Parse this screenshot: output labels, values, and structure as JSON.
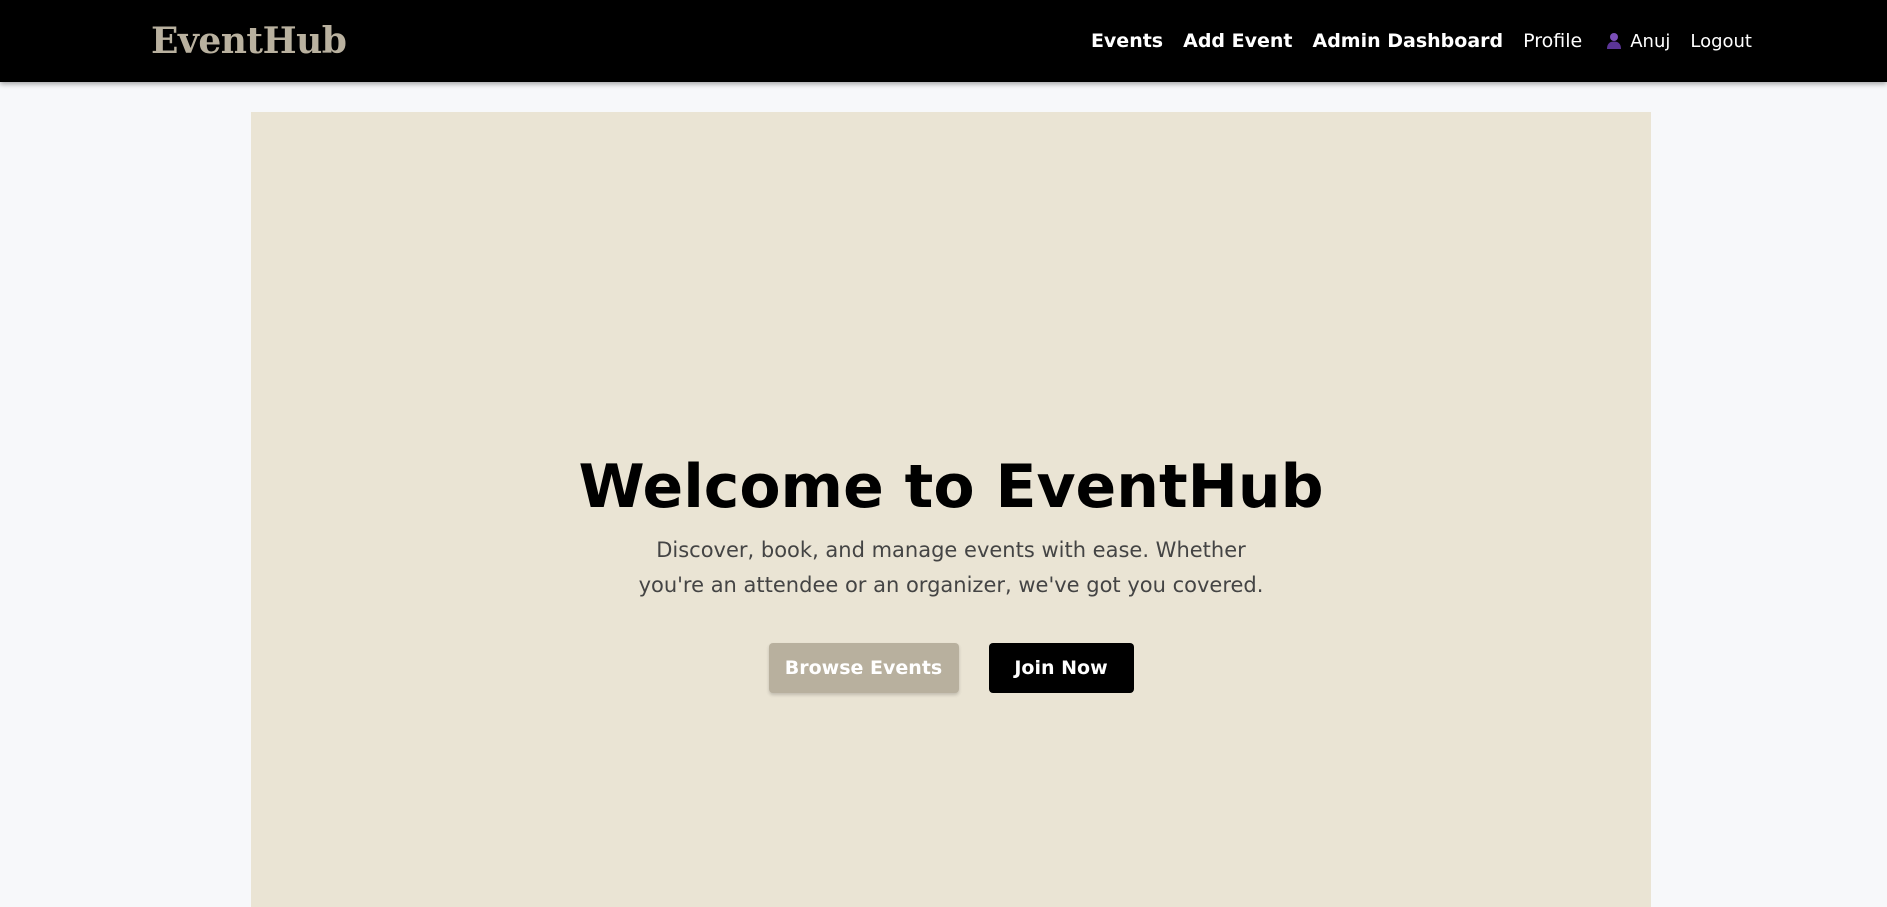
{
  "nav": {
    "brand": "EventHub",
    "links": [
      {
        "label": "Events"
      },
      {
        "label": "Add Event"
      },
      {
        "label": "Admin Dashboard"
      },
      {
        "label": "Profile"
      }
    ],
    "user": {
      "icon": "user-icon",
      "name": "Anuj"
    },
    "logout": "Logout"
  },
  "hero": {
    "title": "Welcome to EventHub",
    "subtitle": "Discover, book, and manage events with ease. Whether you're an attendee or an organizer, we've got you covered.",
    "buttons": {
      "browse": "Browse Events",
      "join": "Join Now"
    }
  },
  "colors": {
    "navbar_bg": "#000000",
    "brand": "#b9b19f",
    "page_bg": "#f7f8fa",
    "hero_bg": "#eae4d4",
    "browse_button": "#b8b09e",
    "join_button": "#000000",
    "user_icon": "#7b4fb8"
  }
}
